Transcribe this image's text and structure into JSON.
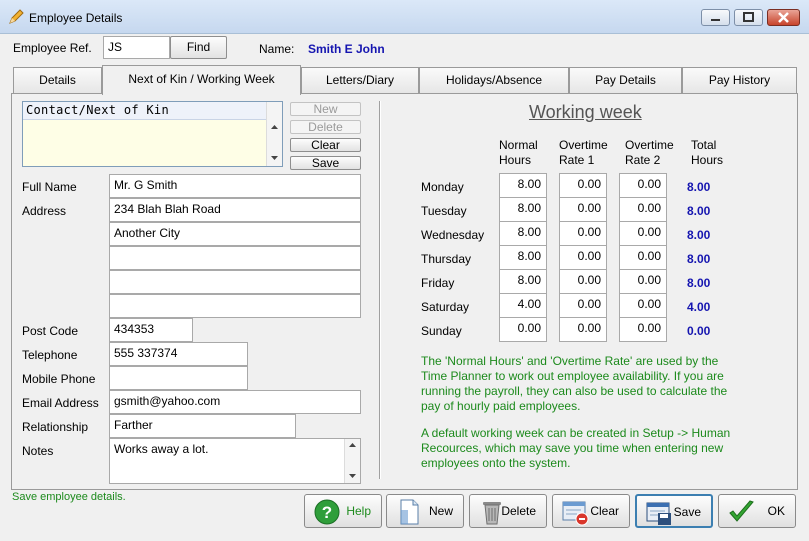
{
  "window": {
    "title": "Employee Details",
    "app_icon": "pencil-icon",
    "minimize_icon": "minimize-icon",
    "maximize_icon": "maximize-icon",
    "close_icon": "close-icon"
  },
  "header": {
    "ref_label": "Employee Ref.",
    "ref_value": "JS",
    "find_label": "Find",
    "name_label": "Name:",
    "name_value": "Smith E John",
    "name_color": "#1515b0"
  },
  "tabs": [
    {
      "label": "Details"
    },
    {
      "label": "Next of Kin / Working Week",
      "active": true
    },
    {
      "label": "Letters/Diary"
    },
    {
      "label": "Holidays/Absence"
    },
    {
      "label": "Pay Details"
    },
    {
      "label": "Pay History"
    }
  ],
  "next_of_kin": {
    "contact_list_header": "Contact/Next of Kin",
    "buttons": {
      "new": "New",
      "delete": "Delete",
      "clear": "Clear",
      "save": "Save"
    },
    "labels": {
      "full_name": "Full Name",
      "address": "Address",
      "post_code": "Post Code",
      "telephone": "Telephone",
      "mobile": "Mobile Phone",
      "email": "Email Address",
      "relationship": "Relationship",
      "notes": "Notes"
    },
    "values": {
      "full_name": "Mr. G Smith",
      "address_lines": [
        "234 Blah Blah Road",
        "Another City",
        "",
        ""
      ],
      "post_code": "434353",
      "telephone": "555 337374",
      "mobile": "",
      "email": "gsmith@yahoo.com",
      "relationship": "Farther",
      "notes": "Works away a lot."
    }
  },
  "working_week": {
    "title": "Working week",
    "columns": {
      "normal": [
        "Normal",
        "Hours"
      ],
      "ot1": [
        "Overtime",
        "Rate 1"
      ],
      "ot2": [
        "Overtime",
        "Rate 2"
      ],
      "total": [
        "Total",
        "Hours"
      ]
    },
    "days": [
      {
        "day": "Monday",
        "normal": "8.00",
        "ot1": "0.00",
        "ot2": "0.00",
        "total": "8.00"
      },
      {
        "day": "Tuesday",
        "normal": "8.00",
        "ot1": "0.00",
        "ot2": "0.00",
        "total": "8.00"
      },
      {
        "day": "Wednesday",
        "normal": "8.00",
        "ot1": "0.00",
        "ot2": "0.00",
        "total": "8.00"
      },
      {
        "day": "Thursday",
        "normal": "8.00",
        "ot1": "0.00",
        "ot2": "0.00",
        "total": "8.00"
      },
      {
        "day": "Friday",
        "normal": "8.00",
        "ot1": "0.00",
        "ot2": "0.00",
        "total": "8.00"
      },
      {
        "day": "Saturday",
        "normal": "4.00",
        "ot1": "0.00",
        "ot2": "0.00",
        "total": "4.00"
      },
      {
        "day": "Sunday",
        "normal": "0.00",
        "ot1": "0.00",
        "ot2": "0.00",
        "total": "0.00"
      }
    ],
    "info1": [
      "The 'Normal Hours' and 'Overtime Rate' are used by the",
      "Time Planner to work out employee availability.  If you are",
      "running the payroll, they can also be used to calculate the",
      "pay of hourly paid employees."
    ],
    "info2": [
      "A default working week can be created in Setup -> Human",
      "Recources, which may save you time when entering new",
      "employees onto the system."
    ],
    "info_color": "#1c8a1c"
  },
  "status": "Save employee details.",
  "footer_buttons": [
    {
      "label": "Help",
      "icon": "help-icon"
    },
    {
      "label": "New",
      "icon": "new-document-icon"
    },
    {
      "label": "Delete",
      "icon": "trash-bin-icon"
    },
    {
      "label": "Clear",
      "icon": "clear-form-icon"
    },
    {
      "label": "Save",
      "icon": "save-icon"
    },
    {
      "label": "OK",
      "icon": "checkmark-icon"
    }
  ]
}
